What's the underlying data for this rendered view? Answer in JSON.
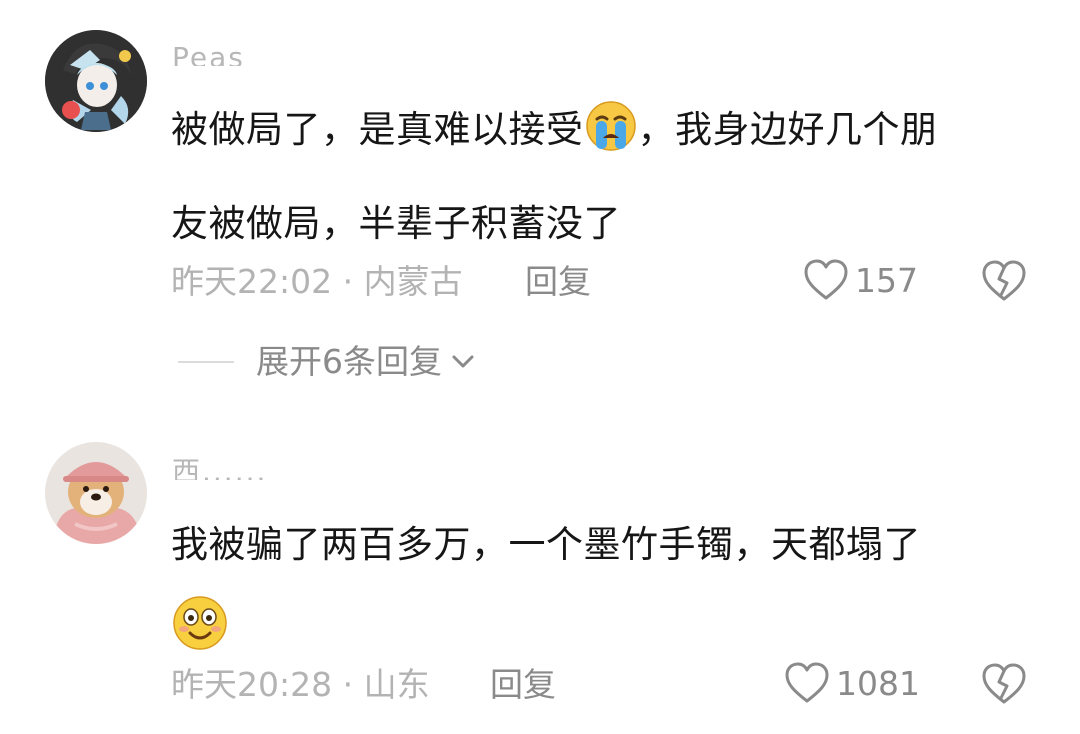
{
  "comments": [
    {
      "username": "Peas",
      "text_line1": "被做局了，是真难以接受",
      "emoji1": "loudly-crying-face",
      "text_line1_tail": "，我身边好几个朋",
      "text_line2": "友被做局，半辈子积蓄没了",
      "timestamp_location": "昨天22:02 · 内蒙古",
      "reply_label": "回复",
      "like_count": "157",
      "expand_replies": "展开6条回复"
    },
    {
      "username": "西......",
      "text_line1": "我被骗了两百多万，一个墨竹手镯，天都塌了",
      "emoji2": "smiling-face-with-big-eyes",
      "timestamp_location": "昨天20:28 · 山东",
      "reply_label": "回复",
      "like_count": "1081"
    }
  ],
  "colors": {
    "text": "#161616",
    "secondary": "#8a8a8a",
    "muted": "#b3b3b3",
    "background": "#ffffff"
  }
}
